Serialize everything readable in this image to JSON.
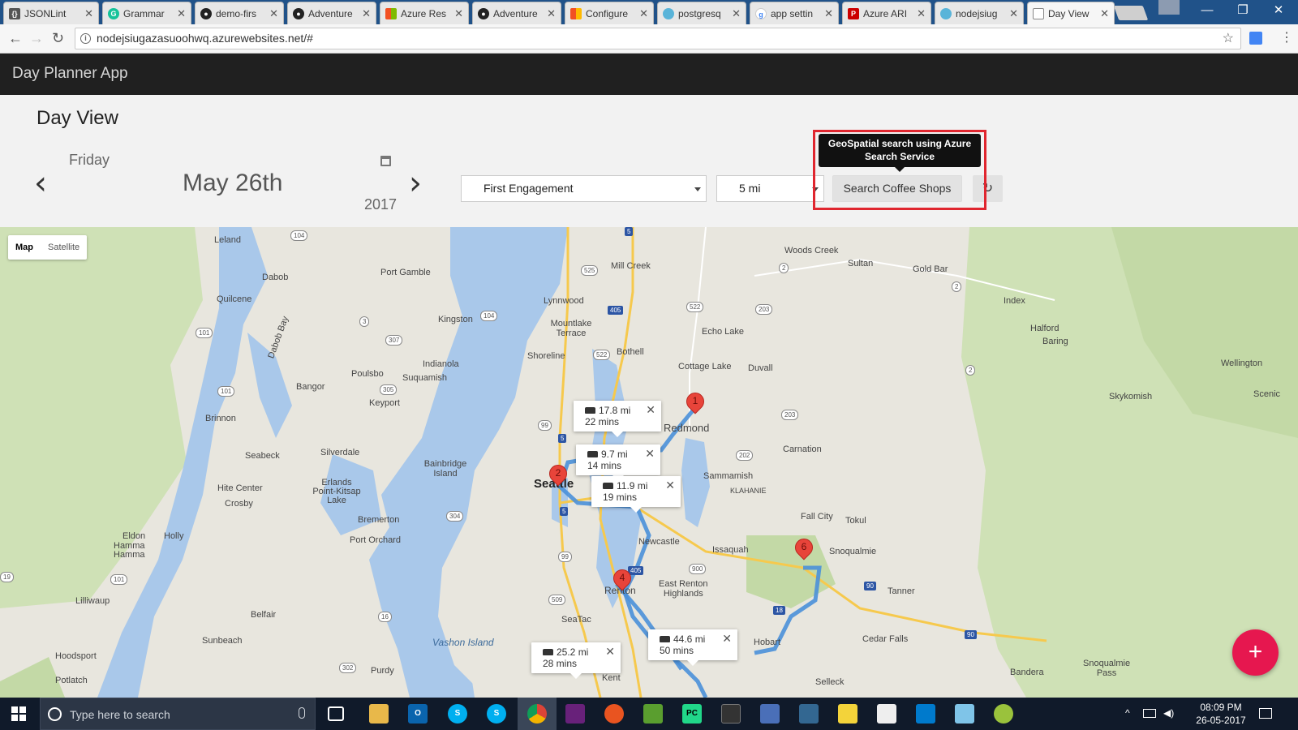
{
  "browser": {
    "tabs": [
      {
        "label": "JSONLint",
        "icon": "json-icon"
      },
      {
        "label": "Grammar",
        "icon": "grammarly-icon"
      },
      {
        "label": "demo-firs",
        "icon": "github-icon"
      },
      {
        "label": "Adventure",
        "icon": "github-icon"
      },
      {
        "label": "Azure Res",
        "icon": "microsoft-icon"
      },
      {
        "label": "Adventure",
        "icon": "github-icon"
      },
      {
        "label": "Configure",
        "icon": "microsoft-icon"
      },
      {
        "label": "postgresq",
        "icon": "cloud-icon"
      },
      {
        "label": "app settin",
        "icon": "google-icon"
      },
      {
        "label": "Azure ARI",
        "icon": "pdf-icon"
      },
      {
        "label": "nodejsiug",
        "icon": "cloud-icon"
      },
      {
        "label": "Day View",
        "icon": "page-icon"
      }
    ],
    "url": "nodejsiugazasuoohwq.azurewebsites.net/#"
  },
  "app": {
    "brand": "Day Planner App",
    "page_title": "Day View",
    "weekday": "Friday",
    "date": "May 26th",
    "year": "2017",
    "engagement_select": "First Engagement",
    "radius_select": "5 mi",
    "search_button": "Search Coffee Shops",
    "tooltip": "GeoSpatial search using Azure Search Service"
  },
  "map": {
    "type_map": "Map",
    "type_satellite": "Satellite",
    "places": {
      "leland": "Leland",
      "port_gamble": "Port Gamble",
      "dabob": "Dabob",
      "quilcene": "Quilcene",
      "mill_creek": "Mill Creek",
      "woods_creek": "Woods Creek",
      "sultan": "Sultan",
      "gold_bar": "Gold Bar",
      "index": "Index",
      "lynnwood": "Lynnwood",
      "mountlake_terrace": "Mountlake\nTerrace",
      "kingston": "Kingston",
      "echo_lake": "Echo Lake",
      "halford": "Halford",
      "baring": "Baring",
      "shoreline": "Shoreline",
      "bothell": "Bothell",
      "cottage_lake": "Cottage Lake",
      "duvall": "Duvall",
      "wellington": "Wellington",
      "dabob_bay": "Dabob Bay",
      "indianola": "Indianola",
      "poulsbo": "Poulsbo",
      "suquamish": "Suquamish",
      "bangor": "Bangor",
      "keyport": "Keyport",
      "skykomish": "Skykomish",
      "scenic": "Scenic",
      "brinnon": "Brinnon",
      "redmond": "Redmond",
      "carnation": "Carnation",
      "seabeck": "Seabeck",
      "silverdale": "Silverdale",
      "bainbridge_island": "Bainbridge\nIsland",
      "sammamish": "Sammamish",
      "seattle": "Seattle",
      "hite_center": "Hite Center",
      "erlands": "Erlands\nPoint-Kitsap\nLake",
      "crosby": "Crosby",
      "klahanie": "KLAHANIE",
      "fall_city": "Fall City",
      "tokul": "Tokul",
      "bremerton": "Bremerton",
      "holly": "Holly",
      "newcastle": "Newcastle",
      "issaquah": "Issaquah",
      "snoqualmie": "Snoqualmie",
      "eldon": "Eldon",
      "hamma": "Hamma\nHamma",
      "port_orchard": "Port Orchard",
      "east_renton": "East Renton\nHighlands",
      "renton": "Renton",
      "tanner": "Tanner",
      "lilliwaup": "Lilliwaup",
      "belfair": "Belfair",
      "seatac": "SeaTac",
      "vashon_island": "Vashon Island",
      "cedar_falls": "Cedar Falls",
      "sunbeach": "Sunbeach",
      "hobart": "Hobart",
      "hoodsport": "Hoodsport",
      "purdy": "Purdy",
      "bandera": "Bandera",
      "snoqualmie_pass": "Snoqualmie\nPass",
      "potlatch": "Potlatch",
      "kent": "Kent",
      "selleck": "Selleck",
      "shoreline_north": "Shoreline"
    },
    "routes": [
      {
        "distance": "17.8 mi",
        "time": "22 mins"
      },
      {
        "distance": "9.7 mi",
        "time": "14 mins"
      },
      {
        "distance": "11.9 mi",
        "time": "19 mins"
      },
      {
        "distance": "44.6 mi",
        "time": "50 mins"
      },
      {
        "distance": "25.2 mi",
        "time": "28 mins"
      }
    ],
    "pins": [
      "1",
      "2",
      "4",
      "6"
    ],
    "route_color": "#4a90d9",
    "pin_color": "#e8443a"
  },
  "fab_label": "+",
  "taskbar": {
    "search_placeholder": "Type here to search",
    "time": "08:09 PM",
    "date": "26-05-2017"
  }
}
